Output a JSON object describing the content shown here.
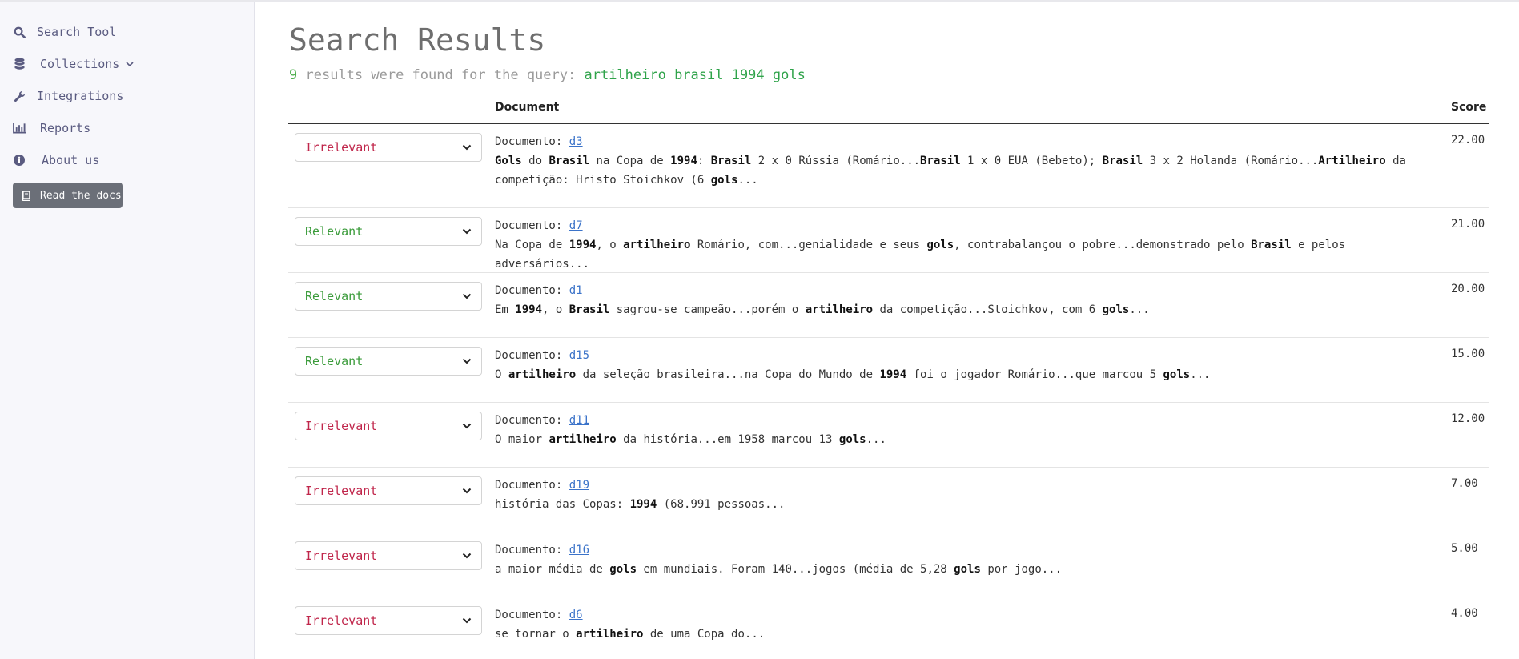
{
  "sidebar": {
    "items": [
      {
        "label": "Search Tool",
        "icon": "search-icon"
      },
      {
        "label": "Collections",
        "icon": "database-icon",
        "has_chevron": true
      },
      {
        "label": "Integrations",
        "icon": "wrench-icon"
      },
      {
        "label": "Reports",
        "icon": "bar-chart-icon"
      },
      {
        "label": "About us",
        "icon": "info-icon"
      }
    ],
    "docs_button": {
      "label": "Read the docs",
      "icon": "book-icon"
    }
  },
  "page": {
    "title": "Search Results",
    "summary": {
      "count": "9",
      "text": " results were found for the query: ",
      "query": "artilheiro brasil 1994 gols"
    }
  },
  "table": {
    "headers": {
      "document": "Document",
      "score": "Score"
    },
    "doc_prefix": "Documento: ",
    "rows": [
      {
        "judgement": "Irrelevant",
        "doc_id": "d3",
        "score": "22.00",
        "snippet": [
          [
            "b",
            "Gols"
          ],
          [
            "t",
            " do "
          ],
          [
            "b",
            "Brasil"
          ],
          [
            "t",
            " na Copa de "
          ],
          [
            "b",
            "1994"
          ],
          [
            "t",
            ": "
          ],
          [
            "b",
            "Brasil"
          ],
          [
            "t",
            " 2 x 0 Rússia (Romário..."
          ],
          [
            "b",
            "Brasil"
          ],
          [
            "t",
            " 1 x 0 EUA (Bebeto); "
          ],
          [
            "b",
            "Brasil"
          ],
          [
            "t",
            " 3 x 2 Holanda (Romário..."
          ],
          [
            "b",
            "Artilheiro"
          ],
          [
            "t",
            " da competição: Hristo Stoichkov (6 "
          ],
          [
            "b",
            "gols"
          ],
          [
            "t",
            "..."
          ]
        ]
      },
      {
        "judgement": "Relevant",
        "doc_id": "d7",
        "score": "21.00",
        "snippet": [
          [
            "t",
            "Na Copa de "
          ],
          [
            "b",
            "1994"
          ],
          [
            "t",
            ", o "
          ],
          [
            "b",
            "artilheiro"
          ],
          [
            "t",
            " Romário, com...genialidade e seus "
          ],
          [
            "b",
            "gols"
          ],
          [
            "t",
            ", contrabalançou o pobre...demonstrado pelo "
          ],
          [
            "b",
            "Brasil"
          ],
          [
            "t",
            " e pelos adversários..."
          ]
        ]
      },
      {
        "judgement": "Relevant",
        "doc_id": "d1",
        "score": "20.00",
        "snippet": [
          [
            "t",
            "Em "
          ],
          [
            "b",
            "1994"
          ],
          [
            "t",
            ", o "
          ],
          [
            "b",
            "Brasil"
          ],
          [
            "t",
            " sagrou-se campeão...porém o "
          ],
          [
            "b",
            "artilheiro"
          ],
          [
            "t",
            " da competição...Stoichkov, com 6 "
          ],
          [
            "b",
            "gols"
          ],
          [
            "t",
            "..."
          ]
        ]
      },
      {
        "judgement": "Relevant",
        "doc_id": "d15",
        "score": "15.00",
        "snippet": [
          [
            "t",
            "O "
          ],
          [
            "b",
            "artilheiro"
          ],
          [
            "t",
            " da seleção brasileira...na Copa do Mundo de "
          ],
          [
            "b",
            "1994"
          ],
          [
            "t",
            " foi o jogador Romário...que marcou 5 "
          ],
          [
            "b",
            "gols"
          ],
          [
            "t",
            "..."
          ]
        ]
      },
      {
        "judgement": "Irrelevant",
        "doc_id": "d11",
        "score": "12.00",
        "snippet": [
          [
            "t",
            "O maior "
          ],
          [
            "b",
            "artilheiro"
          ],
          [
            "t",
            " da história...em 1958 marcou 13 "
          ],
          [
            "b",
            "gols"
          ],
          [
            "t",
            "..."
          ]
        ]
      },
      {
        "judgement": "Irrelevant",
        "doc_id": "d19",
        "score": "7.00",
        "snippet": [
          [
            "t",
            "história das Copas: "
          ],
          [
            "b",
            "1994"
          ],
          [
            "t",
            " (68.991 pessoas..."
          ]
        ]
      },
      {
        "judgement": "Irrelevant",
        "doc_id": "d16",
        "score": "5.00",
        "snippet": [
          [
            "t",
            "a maior média de "
          ],
          [
            "b",
            "gols"
          ],
          [
            "t",
            " em mundiais. Foram 140...jogos (média de 5,28 "
          ],
          [
            "b",
            "gols"
          ],
          [
            "t",
            " por jogo..."
          ]
        ]
      },
      {
        "judgement": "Irrelevant",
        "doc_id": "d6",
        "score": "4.00",
        "snippet": [
          [
            "t",
            "se tornar o "
          ],
          [
            "b",
            "artilheiro"
          ],
          [
            "t",
            " de uma Copa do..."
          ]
        ]
      }
    ]
  },
  "colors": {
    "relevant": "#3a9b3a",
    "irrelevant": "#c0264b",
    "link": "#3b73c9",
    "query": "#2fa34a",
    "nav_text": "#5a5b80"
  }
}
